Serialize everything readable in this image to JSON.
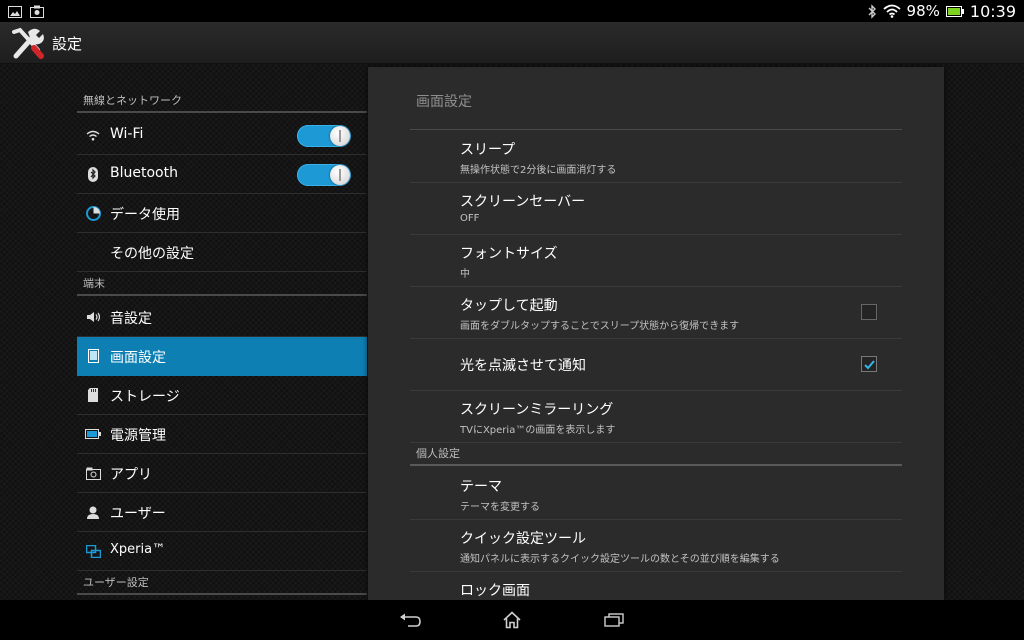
{
  "status_bar": {
    "battery": "98%",
    "time": "10:39",
    "icons": [
      "picture-icon",
      "screenshot-icon",
      "bluetooth-icon",
      "wifi-icon",
      "battery-icon"
    ]
  },
  "action_bar": {
    "title": "設定",
    "icon": "settings-tools-icon"
  },
  "sidebar": {
    "sections": [
      {
        "header": "無線とネットワーク"
      },
      {
        "header": "端末"
      },
      {
        "header": "ユーザー設定"
      }
    ],
    "items": [
      {
        "label": "Wi-Fi",
        "icon": "wifi-icon",
        "toggle": true
      },
      {
        "label": "Bluetooth",
        "icon": "bluetooth-icon",
        "toggle": true
      },
      {
        "label": "データ使用",
        "icon": "data-usage-icon"
      },
      {
        "label": "その他の設定",
        "icon": ""
      },
      {
        "label": "音設定",
        "icon": "speaker-icon"
      },
      {
        "label": "画面設定",
        "icon": "display-icon",
        "selected": true
      },
      {
        "label": "ストレージ",
        "icon": "storage-icon"
      },
      {
        "label": "電源管理",
        "icon": "battery-icon"
      },
      {
        "label": "アプリ",
        "icon": "apps-icon"
      },
      {
        "label": "ユーザー",
        "icon": "user-icon"
      },
      {
        "label": "Xperia™",
        "icon": "xperia-icon"
      }
    ]
  },
  "detail": {
    "title": "画面設定",
    "items": [
      {
        "title": "スリープ",
        "summary": "無操作状態で2分後に画面消灯する"
      },
      {
        "title": "スクリーンセーバー",
        "summary": "OFF"
      },
      {
        "title": "フォントサイズ",
        "summary": "中"
      },
      {
        "title": "タップして起動",
        "summary": "画面をダブルタップすることでスリープ状態から復帰できます",
        "checked": false
      },
      {
        "title": "光を点滅させて通知",
        "summary": "",
        "checked": true
      },
      {
        "title": "スクリーンミラーリング",
        "summary": "TVにXperia™の画面を表示します"
      }
    ],
    "section2": "個人設定",
    "items2": [
      {
        "title": "テーマ",
        "summary": "テーマを変更する"
      },
      {
        "title": "クイック設定ツール",
        "summary": "通知パネルに表示するクイック設定ツールの数とその並び順を編集する"
      },
      {
        "title": "ロック画面",
        "summary": ""
      }
    ]
  },
  "nav_bar": {
    "buttons": [
      "back-icon",
      "home-icon",
      "recent-apps-icon"
    ]
  },
  "colors": {
    "accent": "#0e7fb3",
    "toggle_on": "#1d9ad6",
    "check": "#33b5e5"
  }
}
